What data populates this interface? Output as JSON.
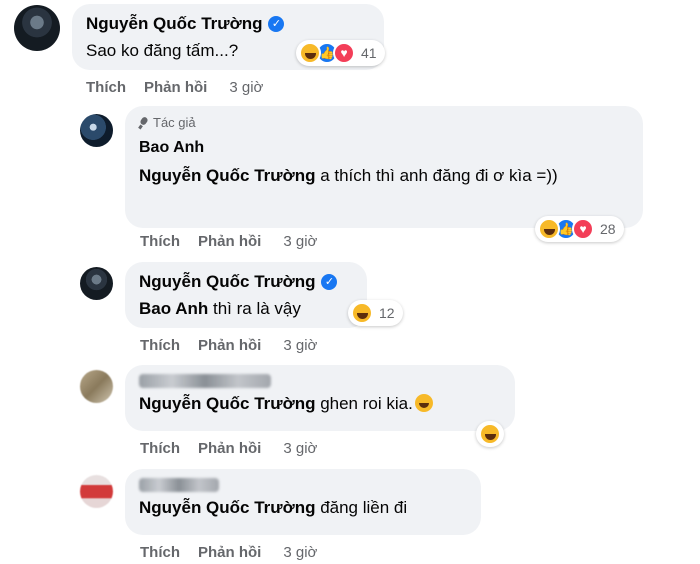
{
  "comments": [
    {
      "author": "Nguyễn Quốc Trường",
      "verified": true,
      "text": "Sao ko đăng tấm...?",
      "reactions": [
        "haha",
        "like",
        "love"
      ],
      "reaction_count": "41",
      "actions": {
        "like": "Thích",
        "reply": "Phản hồi",
        "time": "3 giờ"
      },
      "replies": [
        {
          "author_tag": "Tác giả",
          "author": "Bao Anh",
          "mention": "Nguyễn Quốc Trường",
          "text": " a thích thì anh đăng đi ơ kìa =))",
          "reactions": [
            "haha",
            "like",
            "love"
          ],
          "reaction_count": "28",
          "actions": {
            "like": "Thích",
            "reply": "Phản hồi",
            "time": "3 giờ"
          }
        },
        {
          "author": "Nguyễn Quốc Trường",
          "verified": true,
          "mention": "Bao Anh",
          "text": " thì ra là vậy",
          "reactions": [
            "haha"
          ],
          "reaction_count": "12",
          "actions": {
            "like": "Thích",
            "reply": "Phản hồi",
            "time": "3 giờ"
          }
        },
        {
          "author_hidden": true,
          "mention": "Nguyễn Quốc Trường",
          "text": " ghen roi kia.",
          "reactions": [
            "haha"
          ],
          "actions": {
            "like": "Thích",
            "reply": "Phản hồi",
            "time": "3 giờ"
          }
        },
        {
          "author_hidden": true,
          "mention": "Nguyễn Quốc Trường",
          "text": " đăng liền đi",
          "actions": {
            "like": "Thích",
            "reply": "Phản hồi",
            "time": "3 giờ"
          }
        }
      ]
    }
  ],
  "colors": {
    "bubble": "#f0f2f5",
    "secondary_text": "#65676b",
    "verified": "#1877f2",
    "haha": "#f7b928",
    "like": "#1877f2",
    "love": "#f33e58"
  }
}
